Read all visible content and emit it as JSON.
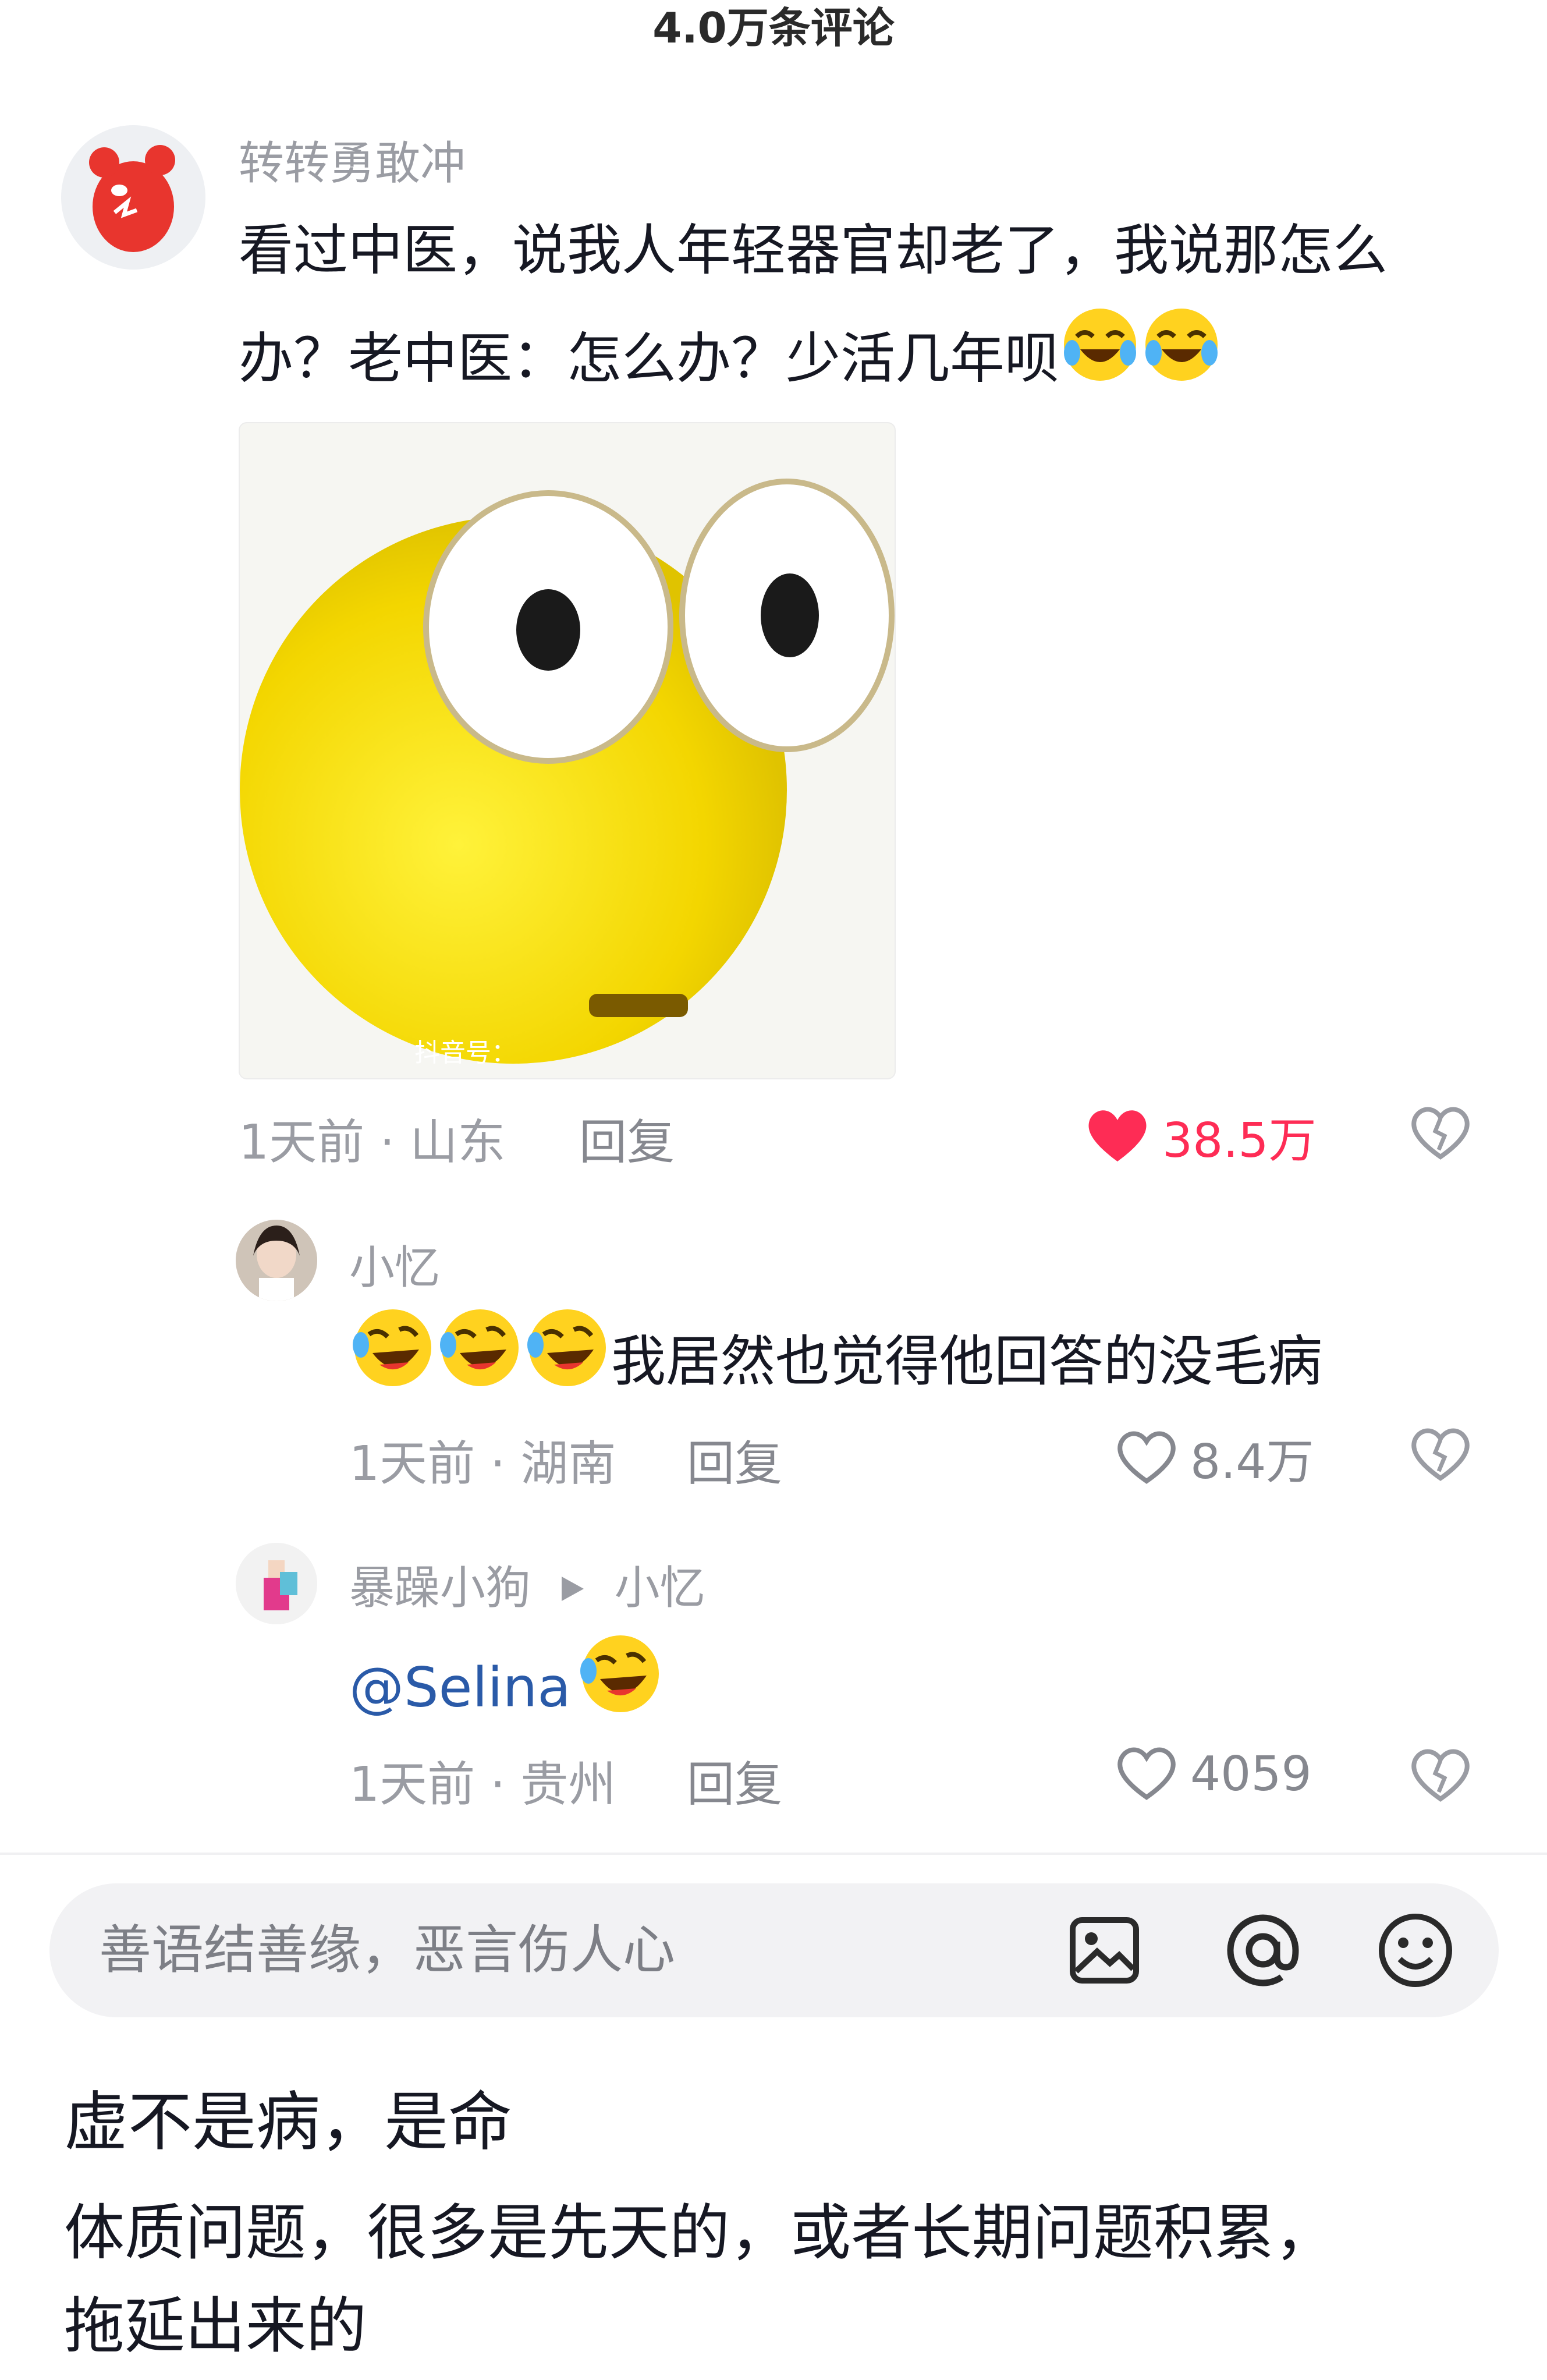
{
  "header": {
    "comment_count": "4.0万条评论"
  },
  "comment": {
    "username": "转转勇敢冲",
    "text_line1": "看过中医，说我人年轻器官却老了，我说那怎么",
    "text_line2": "办？老中医：怎么办？少活几年呗",
    "emoji_trailing": [
      "crying-laugh-emoji",
      "crying-laugh-emoji"
    ],
    "image_watermark": "抖音号：",
    "time": "1天前",
    "location": "山东",
    "reply_label": "回复",
    "likes": "38.5万",
    "liked": true,
    "accent_color": "#fe2c55"
  },
  "replies": [
    {
      "username": "小忆",
      "emoji_leading": [
        "rolling-laugh-emoji",
        "rolling-laugh-emoji",
        "rolling-laugh-emoji"
      ],
      "text": "我居然也觉得他回答的没毛病",
      "time": "1天前",
      "location": "湖南",
      "reply_label": "回复",
      "likes": "8.4万"
    },
    {
      "username": "暴躁小狗",
      "reply_to": "小忆",
      "mention": "@Selina",
      "emoji_trailing": [
        "rolling-laugh-emoji"
      ],
      "time": "1天前",
      "location": "贵州",
      "reply_label": "回复",
      "likes": "4059"
    }
  ],
  "input": {
    "placeholder": "善语结善缘，恶言伤人心",
    "icons": [
      "image-icon",
      "at-icon",
      "emoji-icon"
    ]
  },
  "caption": {
    "title": "虚不是病，是命",
    "body_line1": "体质问题，很多是先天的，或者长期问题积累，",
    "body_line2": "拖延出来的"
  }
}
